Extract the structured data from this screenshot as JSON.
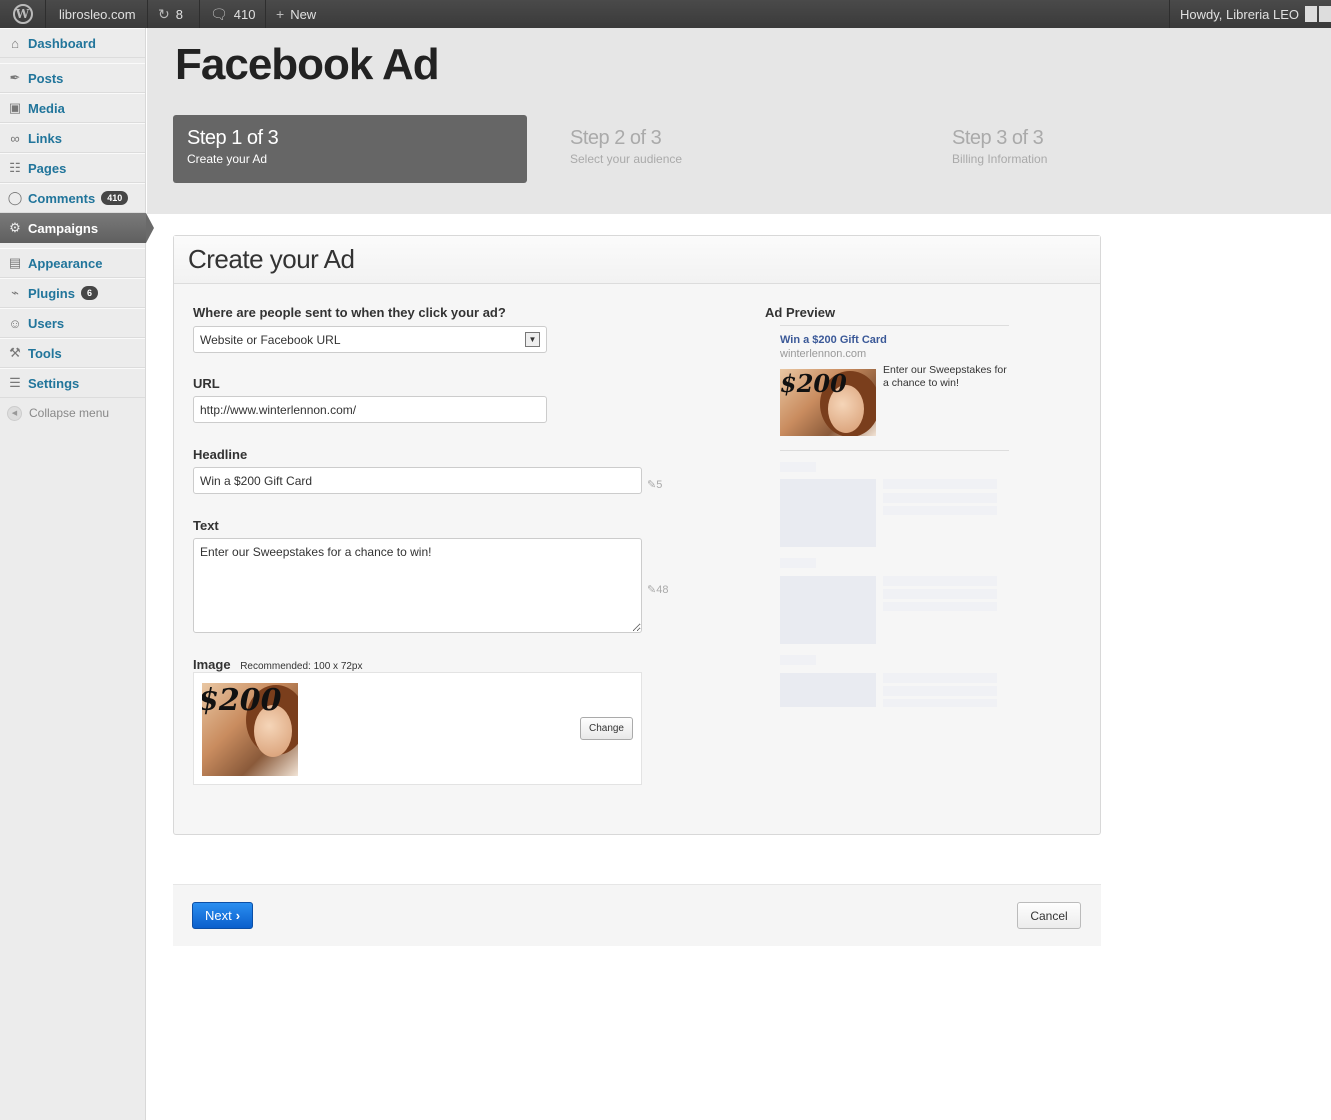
{
  "adminbar": {
    "site": "librosleo.com",
    "updates": "8",
    "comments": "410",
    "new_label": "New",
    "howdy": "Howdy, Libreria LEO"
  },
  "sidebar": {
    "items": [
      {
        "label": "Dashboard",
        "icon": "home-icon"
      },
      {
        "label": "Posts",
        "icon": "pin-icon"
      },
      {
        "label": "Media",
        "icon": "media-icon"
      },
      {
        "label": "Links",
        "icon": "link-icon"
      },
      {
        "label": "Pages",
        "icon": "pages-icon"
      },
      {
        "label": "Comments",
        "icon": "comment-icon",
        "badge": "410"
      },
      {
        "label": "Campaigns",
        "icon": "gear-icon"
      },
      {
        "label": "Appearance",
        "icon": "appearance-icon"
      },
      {
        "label": "Plugins",
        "icon": "plug-icon",
        "badge": "6"
      },
      {
        "label": "Users",
        "icon": "users-icon"
      },
      {
        "label": "Tools",
        "icon": "tools-icon"
      },
      {
        "label": "Settings",
        "icon": "settings-icon"
      }
    ],
    "collapse": "Collapse menu"
  },
  "page": {
    "title": "Facebook Ad"
  },
  "steps": [
    {
      "title": "Step 1 of 3",
      "sub": "Create your Ad"
    },
    {
      "title": "Step 2 of 3",
      "sub": "Select your audience"
    },
    {
      "title": "Step 3 of 3",
      "sub": "Billing Information"
    }
  ],
  "form": {
    "heading": "Create your Ad",
    "destination_label": "Where are people sent to when they click your ad?",
    "destination_value": "Website or Facebook URL",
    "url_label": "URL",
    "url_value": "http://www.winterlennon.com/",
    "headline_label": "Headline",
    "headline_value": "Win a $200 Gift Card",
    "headline_count": "5",
    "text_label": "Text",
    "text_value": "Enter our Sweepstakes for a chance to win!",
    "text_count": "48",
    "image_label": "Image",
    "image_hint": "Recommended: 100 x 72px",
    "image_caption": "$200",
    "change_label": "Change"
  },
  "preview": {
    "title": "Ad Preview",
    "headline": "Win a $200 Gift Card",
    "domain": "winterlennon.com",
    "body": "Enter our Sweepstakes for a chance to win!",
    "image_caption": "$200"
  },
  "footer": {
    "next": "Next",
    "cancel": "Cancel"
  },
  "colors": {
    "link": "#21759b",
    "primary_button": "#0a5fcc",
    "facebook_blue": "#3b5998",
    "active_step": "#666666"
  }
}
